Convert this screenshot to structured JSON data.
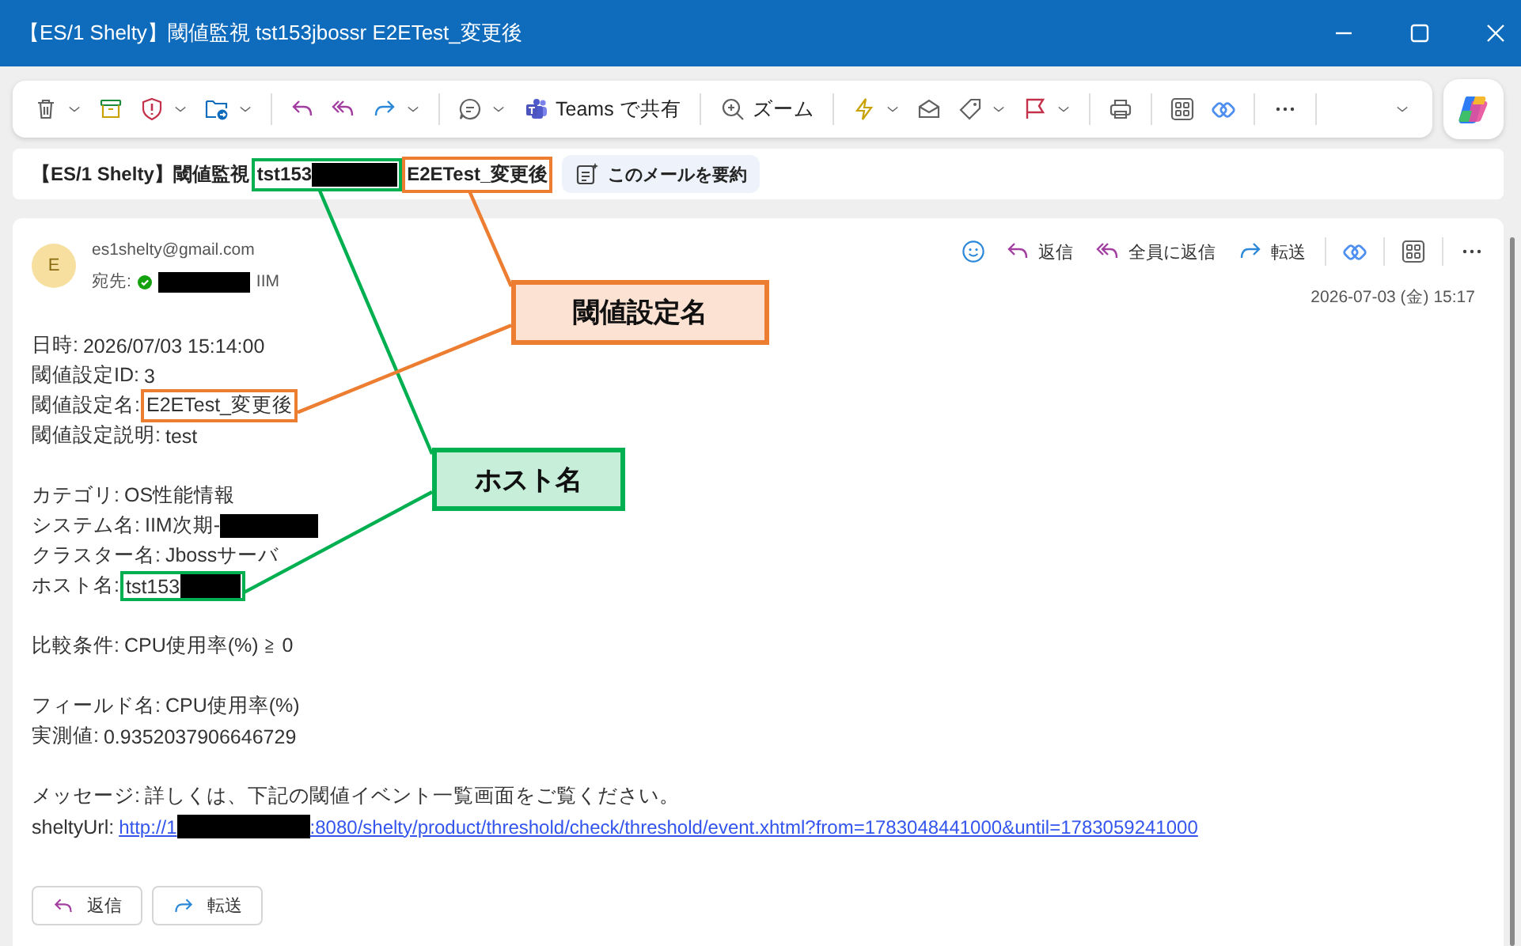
{
  "window": {
    "title": "【ES/1 Shelty】閾値監視 tst153jbossr E2ETest_変更後"
  },
  "toolbar": [
    {
      "kind": "icon",
      "dropdown": true
    },
    {
      "kind": "icon",
      "dropdown": false
    },
    {
      "kind": "icon",
      "dropdown": true
    },
    {
      "kind": "icon",
      "dropdown": true
    },
    {
      "kind": "separator"
    },
    {
      "kind": "icon",
      "dropdown": false
    },
    {
      "kind": "icon",
      "dropdown": false
    },
    {
      "kind": "icon",
      "dropdown": true
    },
    {
      "kind": "separator"
    },
    {
      "kind": "icon",
      "dropdown": true
    },
    {
      "kind": "labeled",
      "label": "Teams で共有",
      "dropdown": false
    },
    {
      "kind": "separator"
    },
    {
      "kind": "labeled",
      "label": "ズーム",
      "dropdown": false
    },
    {
      "kind": "separator"
    },
    {
      "kind": "icon",
      "dropdown": true
    },
    {
      "kind": "icon",
      "dropdown": false
    },
    {
      "kind": "icon",
      "dropdown": true
    },
    {
      "kind": "icon",
      "dropdown": true
    },
    {
      "kind": "separator"
    },
    {
      "kind": "icon",
      "dropdown": false
    },
    {
      "kind": "separator"
    },
    {
      "kind": "icon",
      "dropdown": false
    },
    {
      "kind": "icon",
      "dropdown": false
    },
    {
      "kind": "separator"
    },
    {
      "kind": "icon",
      "dropdown": false
    },
    {
      "kind": "separator"
    },
    {
      "kind": "spacer",
      "dropdown": true
    }
  ],
  "subject": {
    "parts": [
      {
        "text": "【ES/1 Shelty】閾値監視"
      },
      {
        "text": "tst153",
        "redacted": true,
        "color": "#00b050"
      },
      {
        "text": "E2ETest_変更後",
        "color": "#ed7d31"
      }
    ],
    "summary_button": "このメールを要約"
  },
  "message": {
    "avatar": "E",
    "sender": "es1shelty@gmail.com",
    "to_label": "宛先:",
    "recipient_verified": true,
    "recipient_redacted": true,
    "recipient": "IIM",
    "actions": [
      {
        "kind": "icon"
      },
      {
        "kind": "labeled",
        "label": "返信"
      },
      {
        "kind": "labeled",
        "label": "全員に返信"
      },
      {
        "kind": "labeled",
        "label": "転送"
      },
      {
        "kind": "separator"
      },
      {
        "kind": "icon"
      },
      {
        "kind": "separator"
      },
      {
        "kind": "icon"
      },
      {
        "kind": "separator"
      },
      {
        "kind": "icon"
      }
    ],
    "date": "2026-07-03 (金) 15:17",
    "body": [
      [
        {
          "kind": "text",
          "label": "日時:",
          "value": "2026/07/03 15:14:00"
        },
        {
          "kind": "text",
          "label": "閾値設定ID:",
          "value": "3"
        },
        {
          "kind": "text",
          "label": "閾値設定名:",
          "value": "E2ETest_変更後",
          "color": "#ed7d31"
        },
        {
          "kind": "text",
          "label": "閾値設定説明:",
          "value": "test"
        }
      ],
      [
        {
          "kind": "text",
          "label": "カテゴリ:",
          "value": "OS性能情報"
        },
        {
          "kind": "text",
          "label": "システム名:",
          "value": "IIM次期-",
          "redacted": true
        },
        {
          "kind": "text",
          "label": "クラスター名:",
          "value": "Jbossサーバ"
        },
        {
          "kind": "text",
          "label": "ホスト名:",
          "value": "tst153",
          "redacted": true,
          "color": "#00b050"
        }
      ],
      [
        {
          "kind": "text",
          "label": "比較条件:",
          "value": "CPU使用率(%) ≧ 0"
        }
      ],
      [
        {
          "kind": "text",
          "label": "フィールド名:",
          "value": "CPU使用率(%)"
        },
        {
          "kind": "text",
          "label": "実測値:",
          "value": "0.9352037906646729"
        }
      ],
      [
        {
          "kind": "text",
          "label": "メッセージ:",
          "value": "詳しくは、下記の閾値イベント一覧画面をご覧ください。"
        },
        {
          "kind": "link",
          "label": "sheltyUrl:",
          "value": "http://1",
          "redacted": true,
          "value_after": ":8080/shelty/product/threshold/check/threshold/event.xhtml?from=1783048441000&until=1783059241000"
        }
      ]
    ],
    "footer_buttons": [
      "返信",
      "転送"
    ]
  },
  "callouts": [
    {
      "text": "閾値設定名",
      "color": "#ed7d31"
    },
    {
      "text": "ホスト名",
      "color": "#00b050"
    }
  ]
}
